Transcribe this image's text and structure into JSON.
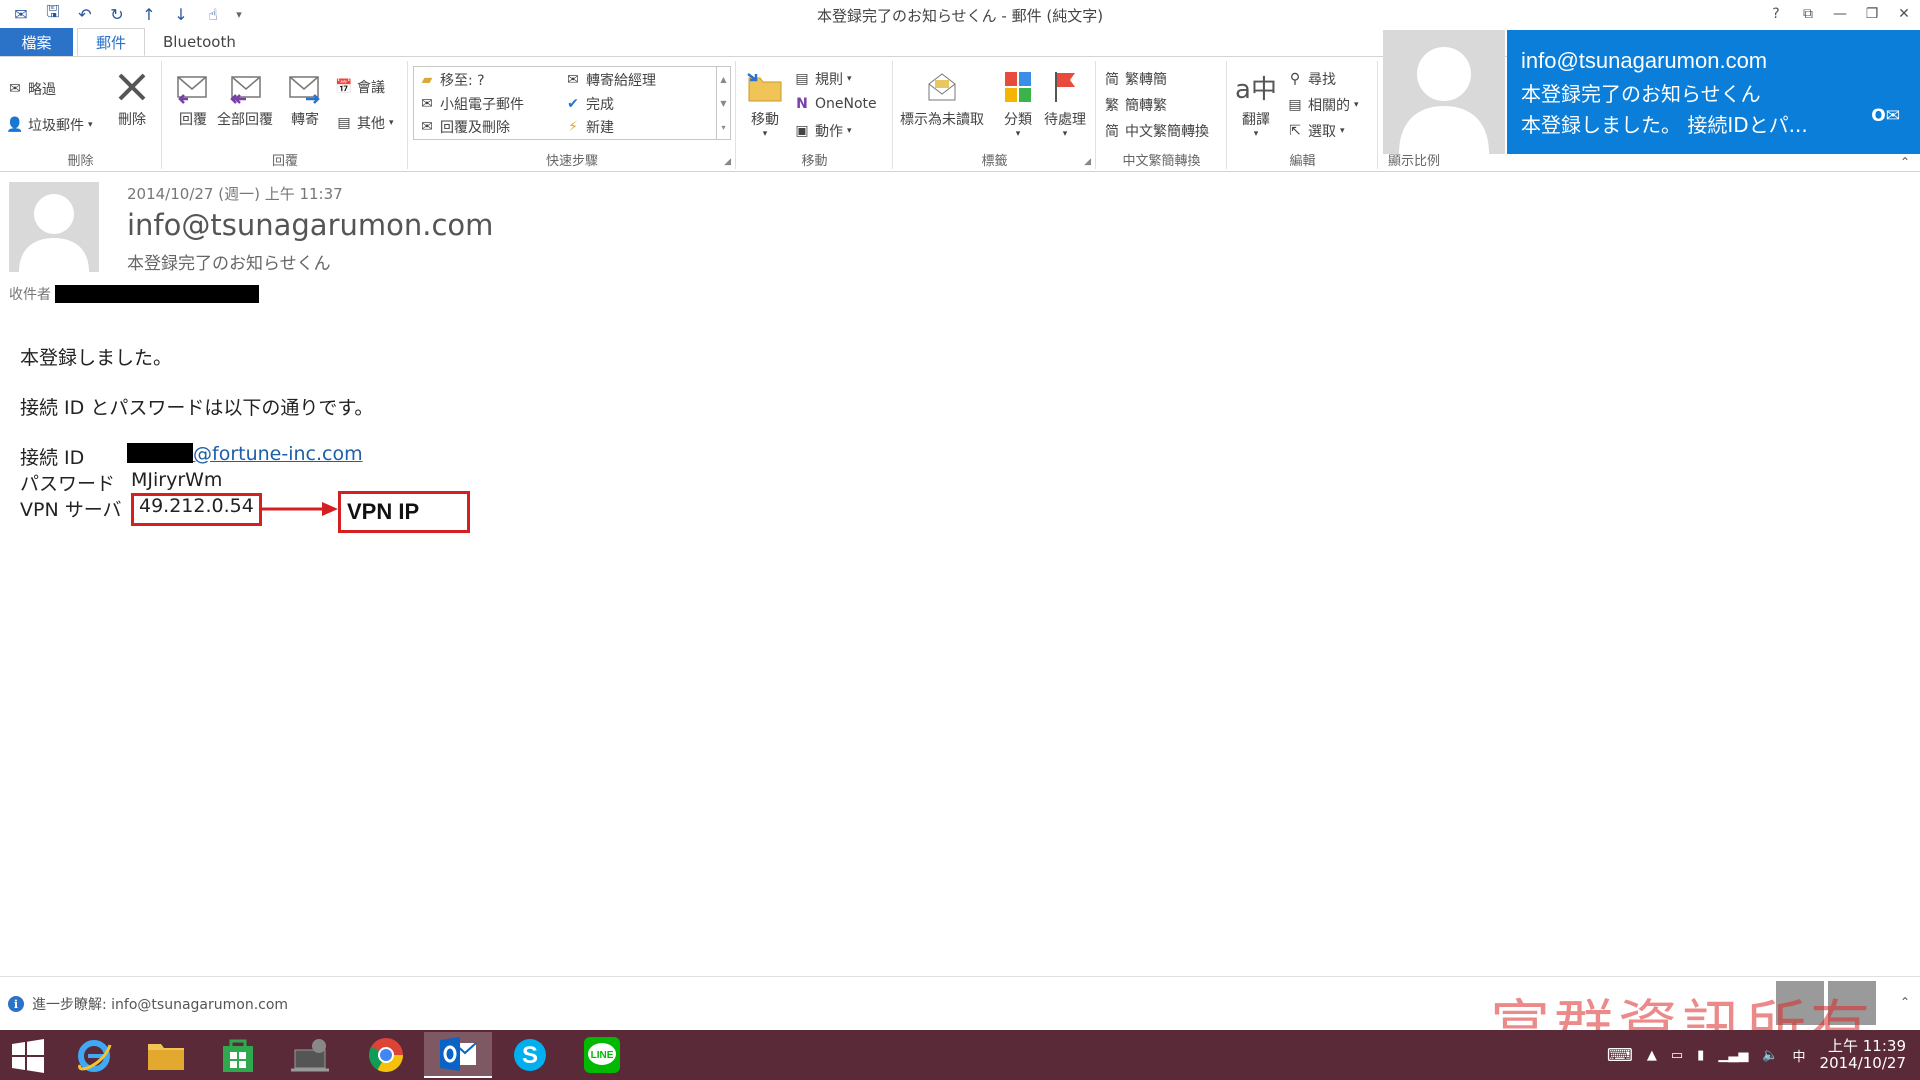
{
  "window": {
    "title": "本登録完了のお知らせくん - 郵件 (純文字)",
    "controls": [
      "?",
      "⧉",
      "—",
      "❐",
      "✕"
    ]
  },
  "tabs": [
    {
      "label": "檔案"
    },
    {
      "label": "郵件"
    },
    {
      "label": "Bluetooth"
    }
  ],
  "ribbon": {
    "delete_group": {
      "label": "刪除",
      "ignore": "略過",
      "junk": "垃圾郵件",
      "delete": "刪除"
    },
    "reply_group": {
      "label": "回覆",
      "reply": "回覆",
      "reply_all": "全部回覆",
      "forward": "轉寄",
      "meeting": "會議",
      "more": "其他"
    },
    "quicksteps_group": {
      "label": "快速步驟",
      "items": [
        "移至: ?",
        "小組電子郵件",
        "回覆及刪除",
        "轉寄給經理",
        "完成",
        "新建"
      ]
    },
    "move_group": {
      "label": "移動",
      "move": "移動",
      "rules": "規則",
      "onenote": "OneNote",
      "actions": "動作"
    },
    "tags_group": {
      "label": "標籤",
      "unread": "標示為未讀取",
      "categorize": "分類",
      "followup": "待處理"
    },
    "chinese_group": {
      "label": "中文繁簡轉換",
      "to_simplified": "繁轉簡",
      "to_traditional": "簡轉繁",
      "convert": "中文繁簡轉換"
    },
    "editing_group": {
      "label": "編輯",
      "translate": "翻譯",
      "find": "尋找",
      "related": "相關的",
      "select": "選取"
    },
    "zoom_group": {
      "label": "顯示比例"
    }
  },
  "notification": {
    "sender": "info@tsunagarumon.com",
    "subject": "本登録完了のお知らせくん",
    "preview": "本登録しました。 接続IDとパ...",
    "icon_text": "O✉"
  },
  "message": {
    "date": "2014/10/27 (週一) 上午 11:37",
    "from": "info@tsunagarumon.com",
    "subject": "本登録完了のお知らせくん",
    "to_label": "收件者"
  },
  "body": {
    "line1": "本登録しました。",
    "line2": "接続 ID とパスワードは以下の通りです。",
    "id_label": "接続 ID",
    "id_domain": "@fortune-inc.com",
    "password_label": "パスワード",
    "password_value": "MJiryrWm",
    "vpn_label": "VPN サーバ",
    "vpn_value": "49.212.0.54",
    "annotation": "VPN IP"
  },
  "infobar": {
    "text": "進一步瞭解: info@tsunagarumon.com",
    "watermark": "富群資訊所有"
  },
  "taskbar": {
    "apps": [
      "internet-explorer",
      "file-explorer",
      "store",
      "remote-desktop",
      "chrome",
      "outlook",
      "skype",
      "line"
    ],
    "ime": "中",
    "time": "上午 11:39",
    "date": "2014/10/27"
  },
  "colors": {
    "accent": "#2b73c8",
    "toast": "#0a7ed8",
    "annotation_red": "#d32020",
    "taskbar": "#5a2a38"
  }
}
